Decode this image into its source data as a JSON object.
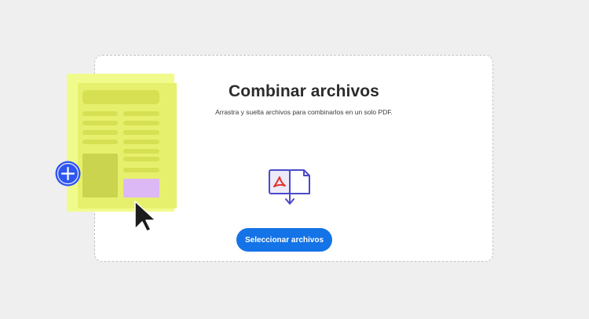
{
  "main": {
    "title": "Combinar archivos",
    "subtitle": "Arrastra y suelta archivos para combinarlos en un solo PDF.",
    "select_button_label": "Seleccionar archivos"
  },
  "icons": {
    "combine": "combine-pdf-icon",
    "add": "plus-circle-icon",
    "cursor": "mouse-pointer-icon"
  },
  "colors": {
    "page_background": "#efefef",
    "card_background": "#ffffff",
    "card_border": "#c4c4c4",
    "primary_button": "#1473e6",
    "illustration_yellow": "#f1fb8b",
    "illustration_accent": "#dcb8f4",
    "add_button": "#2f55f2",
    "pdf_red": "#e3342f",
    "icon_outline": "#4a4acb"
  }
}
